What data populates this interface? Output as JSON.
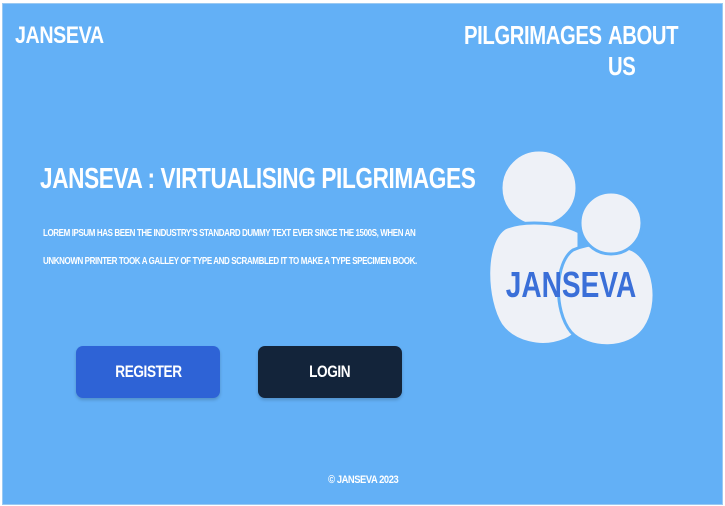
{
  "header": {
    "brand": "JANSEVA",
    "nav": [
      {
        "label": "PILGRIMAGES"
      },
      {
        "label": "ABOUT US"
      }
    ]
  },
  "hero": {
    "title": "JANSEVA : VIRTUALISING PILGRIMAGES",
    "description": "LOREM IPSUM HAS BEEN THE INDUSTRY'S STANDARD DUMMY TEXT EVER SINCE THE 1500S, WHEN AN UNKNOWN PRINTER TOOK A GALLEY OF TYPE AND SCRAMBLED IT TO MAKE A TYPE SPECIMEN BOOK.",
    "register_label": "REGISTER",
    "login_label": "LOGIN"
  },
  "logo": {
    "text": "JANSEVA",
    "icon": "people-icon"
  },
  "footer": {
    "copyright": "© JANSEVA 2023"
  },
  "colors": {
    "background": "#63b0f6",
    "register": "#2e63d6",
    "login": "#13243a",
    "logo_fill": "#eef1f7",
    "logo_text": "#3a6fd8"
  }
}
